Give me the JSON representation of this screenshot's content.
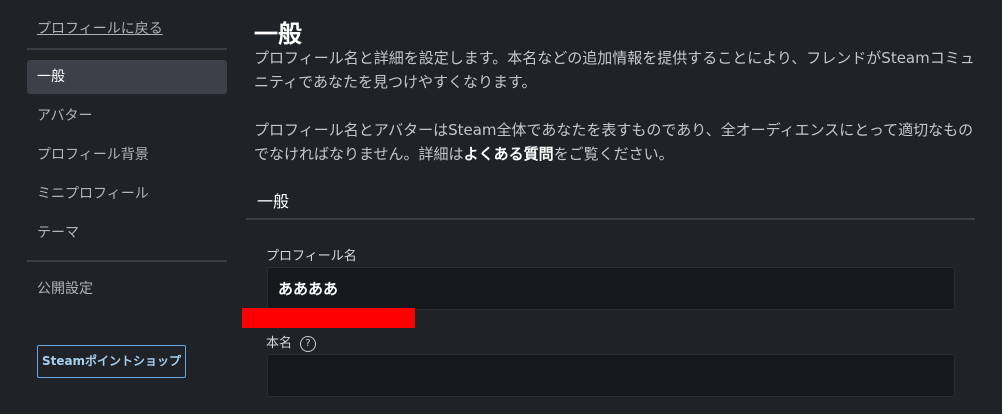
{
  "sidebar": {
    "back_link": "プロフィールに戻る",
    "items": [
      {
        "label": "一般",
        "active": true
      },
      {
        "label": "アバター"
      },
      {
        "label": "プロフィール背景"
      },
      {
        "label": "ミニプロフィール"
      },
      {
        "label": "テーマ"
      }
    ],
    "privacy_label": "公開設定",
    "points_shop_button": "Steamポイントショップ"
  },
  "main": {
    "title": "一般",
    "desc1": "プロフィール名と詳細を設定します。本名などの追加情報を提供することにより、フレンドがSteamコミュニティであなたを見つけやすくなります。",
    "desc2_part1": "プロフィール名とアバターはSteam全体であなたを表すものであり、全オーディエンスにとって適切なものでなければなりません。詳細は",
    "desc2_link": "よくある質問",
    "desc2_part2": "をご覧ください。",
    "section_title": "一般",
    "profile_name_label": "プロフィール名",
    "profile_name_value": "ああああ",
    "real_name_label": "本名",
    "help_glyph": "?",
    "real_name_value": ""
  }
}
